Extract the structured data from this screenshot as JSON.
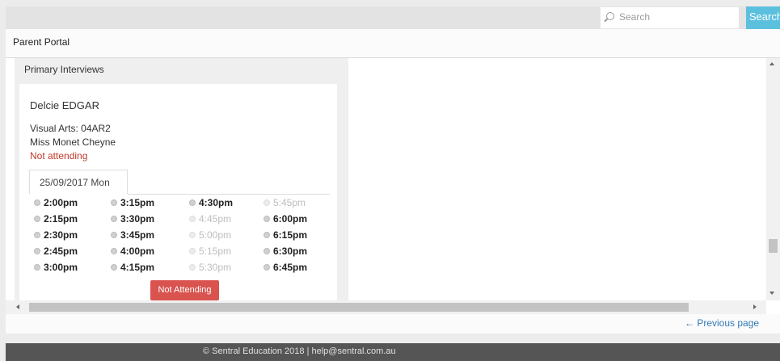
{
  "header": {
    "search_placeholder": "Search",
    "search_button_label": "Search",
    "portal_title": "Parent Portal"
  },
  "panel": {
    "heading": "Primary Interviews",
    "student_name": "Delcie EDGAR",
    "subject_class": "Visual Arts: 04AR2",
    "teacher_name": "Miss Monet Cheyne",
    "attendance_status": "Not attending",
    "date_tab_label": "25/09/2017 Mon",
    "not_attending_button_label": "Not Attending"
  },
  "timeslot_columns": [
    [
      {
        "time": "2:00pm",
        "available": true
      },
      {
        "time": "2:15pm",
        "available": true
      },
      {
        "time": "2:30pm",
        "available": true
      },
      {
        "time": "2:45pm",
        "available": true
      },
      {
        "time": "3:00pm",
        "available": true
      }
    ],
    [
      {
        "time": "3:15pm",
        "available": true
      },
      {
        "time": "3:30pm",
        "available": true
      },
      {
        "time": "3:45pm",
        "available": true
      },
      {
        "time": "4:00pm",
        "available": true
      },
      {
        "time": "4:15pm",
        "available": true
      }
    ],
    [
      {
        "time": "4:30pm",
        "available": true
      },
      {
        "time": "4:45pm",
        "available": false
      },
      {
        "time": "5:00pm",
        "available": false
      },
      {
        "time": "5:15pm",
        "available": false
      },
      {
        "time": "5:30pm",
        "available": false
      }
    ],
    [
      {
        "time": "5:45pm",
        "available": false
      },
      {
        "time": "6:00pm",
        "available": true
      },
      {
        "time": "6:15pm",
        "available": true
      },
      {
        "time": "6:30pm",
        "available": true
      },
      {
        "time": "6:45pm",
        "available": true
      }
    ]
  ],
  "footer": {
    "previous_page_label": "← Previous page",
    "copyright_text": "© Sentral Education 2018 | help@sentral.com.au"
  },
  "colors": {
    "search_button": "#5bc0de",
    "not_attending": "#d9534f",
    "status_text": "#c0392b",
    "link": "#337ab7"
  }
}
